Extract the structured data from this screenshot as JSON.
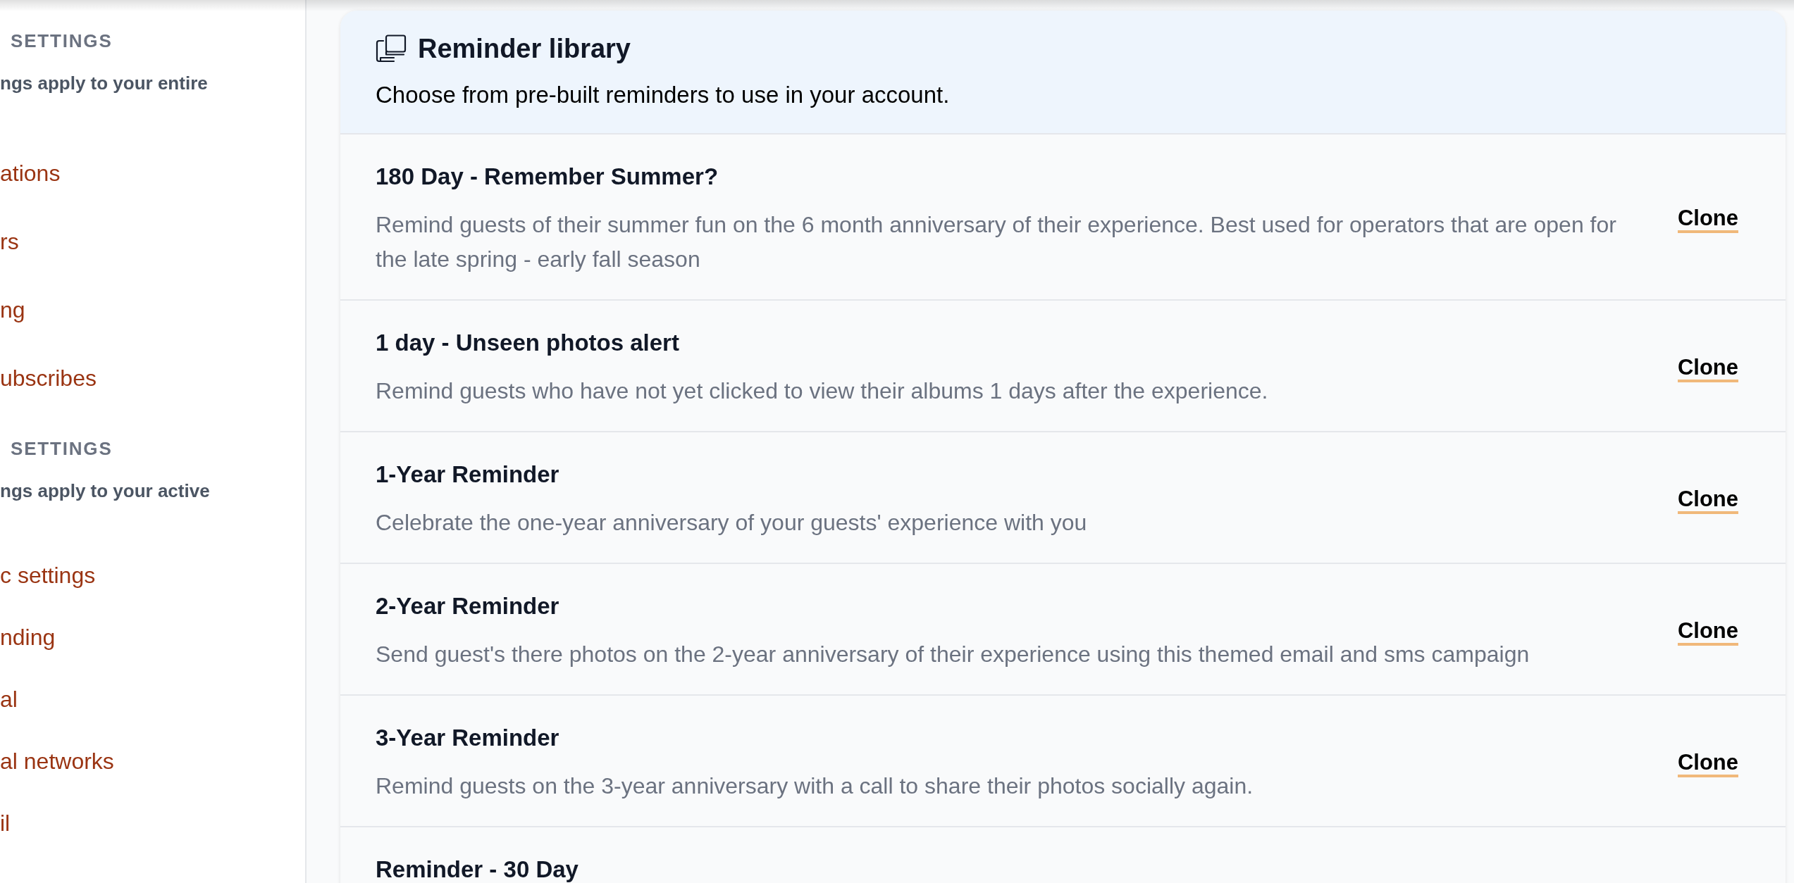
{
  "sidebar": {
    "sections": [
      {
        "heading": "SETTINGS",
        "description": "ngs apply to your entire",
        "items": [
          "ations",
          "rs",
          "ng",
          "ubscribes"
        ]
      },
      {
        "heading": "SETTINGS",
        "description": "ngs apply to your active",
        "items": [
          "c settings",
          "nding",
          "al",
          "al networks",
          "il"
        ]
      }
    ]
  },
  "library": {
    "title": "Reminder library",
    "subtitle": "Choose from pre-built reminders to use in your account.",
    "reminders": [
      {
        "title": "180 Day - Remember Summer?",
        "description": "Remind guests of their summer fun on the 6 month anniversary of their experience. Best used for operators that are open for the late spring - early fall season",
        "action": "Clone"
      },
      {
        "title": "1 day - Unseen photos alert",
        "description": "Remind guests who have not yet clicked to view their albums 1 days after the experience.",
        "action": "Clone"
      },
      {
        "title": "1-Year Reminder",
        "description": "Celebrate the one-year anniversary of your guests' experience with you",
        "action": "Clone"
      },
      {
        "title": "2-Year Reminder",
        "description": "Send guest's there photos on the 2-year anniversary of their experience using this themed email and sms campaign",
        "action": "Clone"
      },
      {
        "title": "3-Year Reminder",
        "description": "Remind guests on the 3-year anniversary with a call to share their photos socially again.",
        "action": "Clone"
      },
      {
        "title": "Reminder - 30 Day"
      }
    ]
  }
}
